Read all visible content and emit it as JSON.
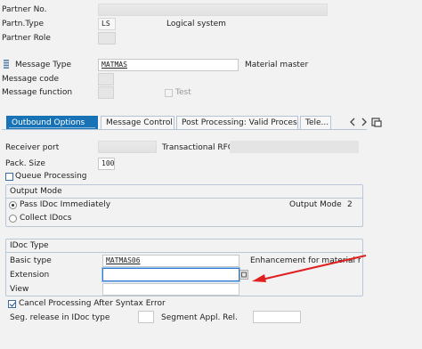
{
  "partner": {
    "number_label": "Partner No.",
    "type_label": "Partn.Type",
    "type_value": "LS",
    "type_desc": "Logical system",
    "role_label": "Partner Role"
  },
  "message": {
    "type_label": "Message Type",
    "type_value": "MATMAS",
    "type_desc": "Material master",
    "code_label": "Message code",
    "function_label": "Message function",
    "test_label": "Test"
  },
  "tabs": [
    {
      "label": "Outbound Options",
      "active": true
    },
    {
      "label": "Message Control"
    },
    {
      "label": "Post Processing: Valid Processors"
    },
    {
      "label": "Tele..."
    }
  ],
  "outbound": {
    "receiver_port_label": "Receiver port",
    "receiver_port_desc": "Transactional RFC",
    "pack_size_label": "Pack. Size",
    "pack_size_value": "100",
    "queue_label": "Queue Processing"
  },
  "output_mode": {
    "title": "Output Mode",
    "pass_label": "Pass IDoc Immediately",
    "collect_label": "Collect IDocs",
    "mode_label": "Output Mode",
    "mode_value": "2"
  },
  "idoc_type": {
    "title": "IDoc Type",
    "basic_label": "Basic type",
    "basic_value": "MATMAS06",
    "basic_desc": "Enhancement for material ma...",
    "extension_label": "Extension",
    "view_label": "View",
    "cancel_label": "Cancel Processing After Syntax Error",
    "seg_release_label": "Seg. release in IDoc type",
    "seg_appl_label": "Segment Appl. Rel."
  },
  "colors": {
    "tab_active": "#1873b6",
    "arrow": "#e02020",
    "group_border": "#b9c7d6"
  }
}
